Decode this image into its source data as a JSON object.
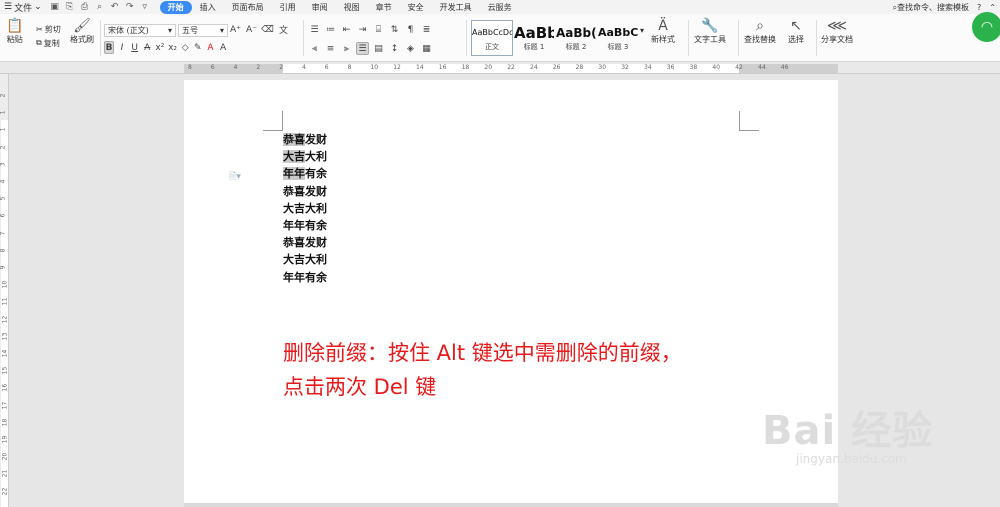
{
  "menubar": {
    "file_label": "文件",
    "tabs": [
      "开始",
      "插入",
      "页面布局",
      "引用",
      "审阅",
      "视图",
      "章节",
      "安全",
      "开发工具",
      "云服务"
    ],
    "search_label": "查找命令、搜索模板",
    "help_label": "?"
  },
  "ribbon": {
    "paste": "粘贴",
    "cut": "剪切",
    "copy": "复制",
    "format_painter": "格式刷",
    "font_name": "宋体 (正文)",
    "font_size": "五号",
    "styles": [
      {
        "preview": "AaBbCcDd",
        "label": "正文"
      },
      {
        "preview": "AaBb",
        "label": "标题 1"
      },
      {
        "preview": "AaBb(",
        "label": "标题 2"
      },
      {
        "preview": "AaBbC",
        "label": "标题 3"
      }
    ],
    "new_style": "新样式",
    "text_tools": "文字工具",
    "find_replace": "查找替换",
    "select": "选择",
    "share_doc": "分享文档"
  },
  "ruler_h": [
    "8",
    "6",
    "4",
    "2",
    "2",
    "4",
    "6",
    "8",
    "10",
    "12",
    "14",
    "16",
    "18",
    "20",
    "22",
    "24",
    "26",
    "28",
    "30",
    "32",
    "34",
    "36",
    "38",
    "40",
    "42",
    "44",
    "46"
  ],
  "ruler_v": [
    "2",
    "1",
    "1",
    "2",
    "3",
    "4",
    "5",
    "6",
    "7",
    "8",
    "9",
    "10",
    "11",
    "12",
    "13",
    "14",
    "15",
    "16",
    "17",
    "18",
    "19",
    "20",
    "21",
    "22"
  ],
  "document": {
    "lines": [
      {
        "pre": "恭喜",
        "post": "发财"
      },
      {
        "pre": "大吉",
        "post": "大利"
      },
      {
        "pre": "年年",
        "post": "有余"
      },
      {
        "pre": "",
        "post": "恭喜发财"
      },
      {
        "pre": "",
        "post": "大吉大利"
      },
      {
        "pre": "",
        "post": "年年有余"
      },
      {
        "pre": "",
        "post": "恭喜发财"
      },
      {
        "pre": "",
        "post": "大吉大利"
      },
      {
        "pre": "",
        "post": "年年有余"
      }
    ],
    "note_line1": "删除前缀：按住 Alt 键选中需删除的前缀，",
    "note_line2": "点击两次 Del 键"
  },
  "watermark": {
    "brand": "Bai 经验",
    "url": "jingyan.baidu.com"
  }
}
